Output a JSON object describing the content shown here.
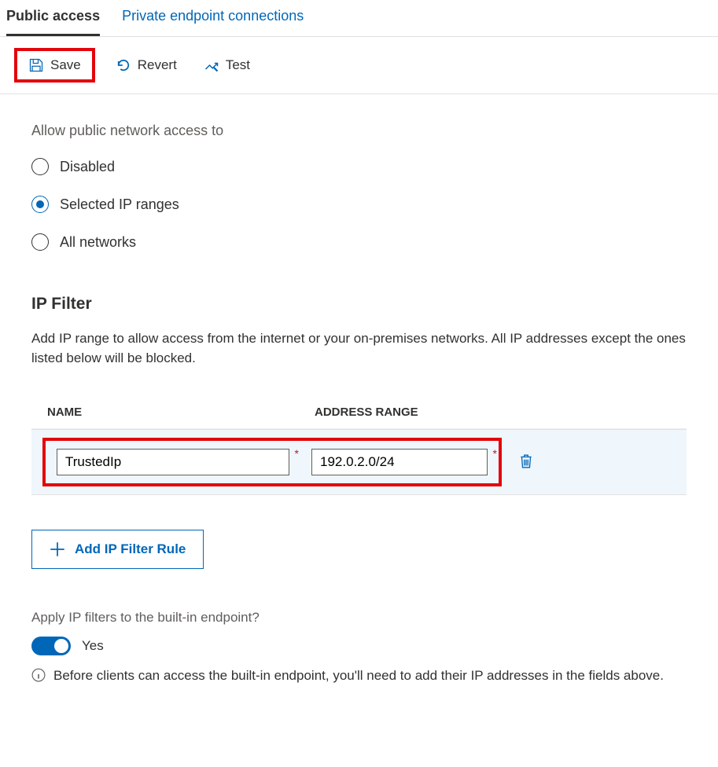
{
  "tabs": {
    "public": "Public access",
    "private": "Private endpoint connections"
  },
  "toolbar": {
    "save": "Save",
    "revert": "Revert",
    "test": "Test"
  },
  "access": {
    "label": "Allow public network access to",
    "options": {
      "disabled": "Disabled",
      "selected_ip": "Selected IP ranges",
      "all": "All networks"
    }
  },
  "ipfilter": {
    "heading": "IP Filter",
    "description": "Add IP range to allow access from the internet or your on-premises networks. All IP addresses except the ones listed below will be blocked.",
    "columns": {
      "name": "NAME",
      "address": "ADDRESS RANGE"
    },
    "rows": [
      {
        "name": "TrustedIp",
        "address": "192.0.2.0/24"
      }
    ],
    "add_button": "Add IP Filter Rule"
  },
  "builtin": {
    "label": "Apply IP filters to the built-in endpoint?",
    "toggle_value": "Yes",
    "info": "Before clients can access the built-in endpoint, you'll need to add their IP addresses in the fields above."
  }
}
